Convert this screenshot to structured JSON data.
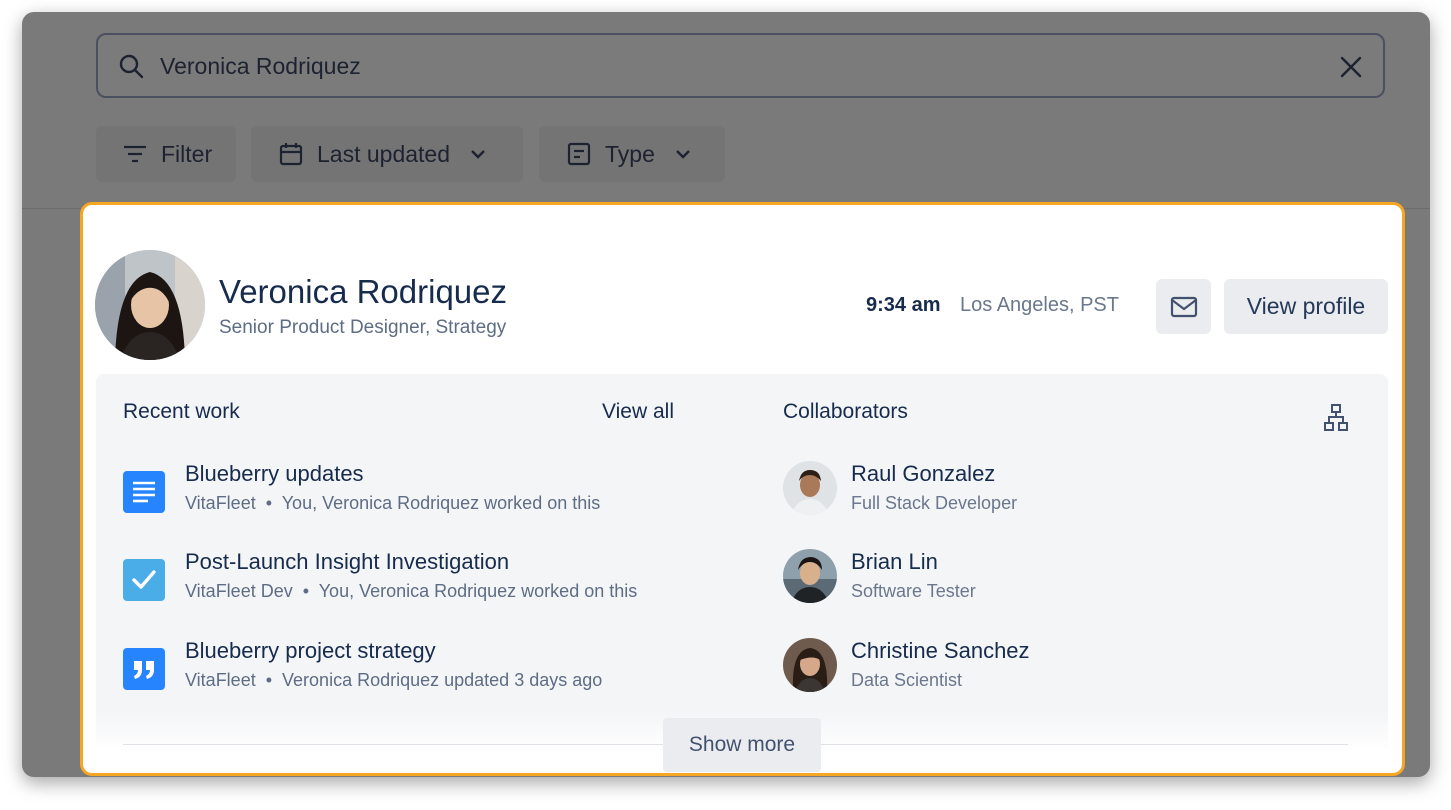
{
  "search": {
    "query": "Veronica Rodriquez"
  },
  "filters": {
    "filter_label": "Filter",
    "last_updated_label": "Last updated",
    "type_label": "Type"
  },
  "profile": {
    "name": "Veronica Rodriquez",
    "title": "Senior Product Designer, Strategy",
    "time": "9:34 am",
    "location": "Los Angeles, PST",
    "view_profile_label": "View profile"
  },
  "recent_work": {
    "heading": "Recent work",
    "view_all_label": "View all",
    "items": [
      {
        "icon": "document-icon",
        "title": "Blueberry updates",
        "space": "VitaFleet",
        "note": "You, Veronica Rodriquez worked on this",
        "color": "#2684ff"
      },
      {
        "icon": "checkbox-icon",
        "title": "Post-Launch Insight Investigation",
        "space": "VitaFleet Dev",
        "note": "You, Veronica Rodriquez worked on this",
        "color": "#4bade8"
      },
      {
        "icon": "quote-icon",
        "title": "Blueberry project strategy",
        "space": "VitaFleet",
        "note": "Veronica Rodriquez updated 3 days ago",
        "color": "#2684ff"
      }
    ]
  },
  "collaborators": {
    "heading": "Collaborators",
    "people": [
      {
        "name": "Raul Gonzalez",
        "role": "Full Stack Developer"
      },
      {
        "name": "Brian Lin",
        "role": "Software Tester"
      },
      {
        "name": "Christine Sanchez",
        "role": "Data Scientist"
      }
    ]
  },
  "show_more_label": "Show more",
  "colors": {
    "accent_border": "#f5a623",
    "text_primary": "#172b4d",
    "text_secondary": "#5e6c84"
  }
}
